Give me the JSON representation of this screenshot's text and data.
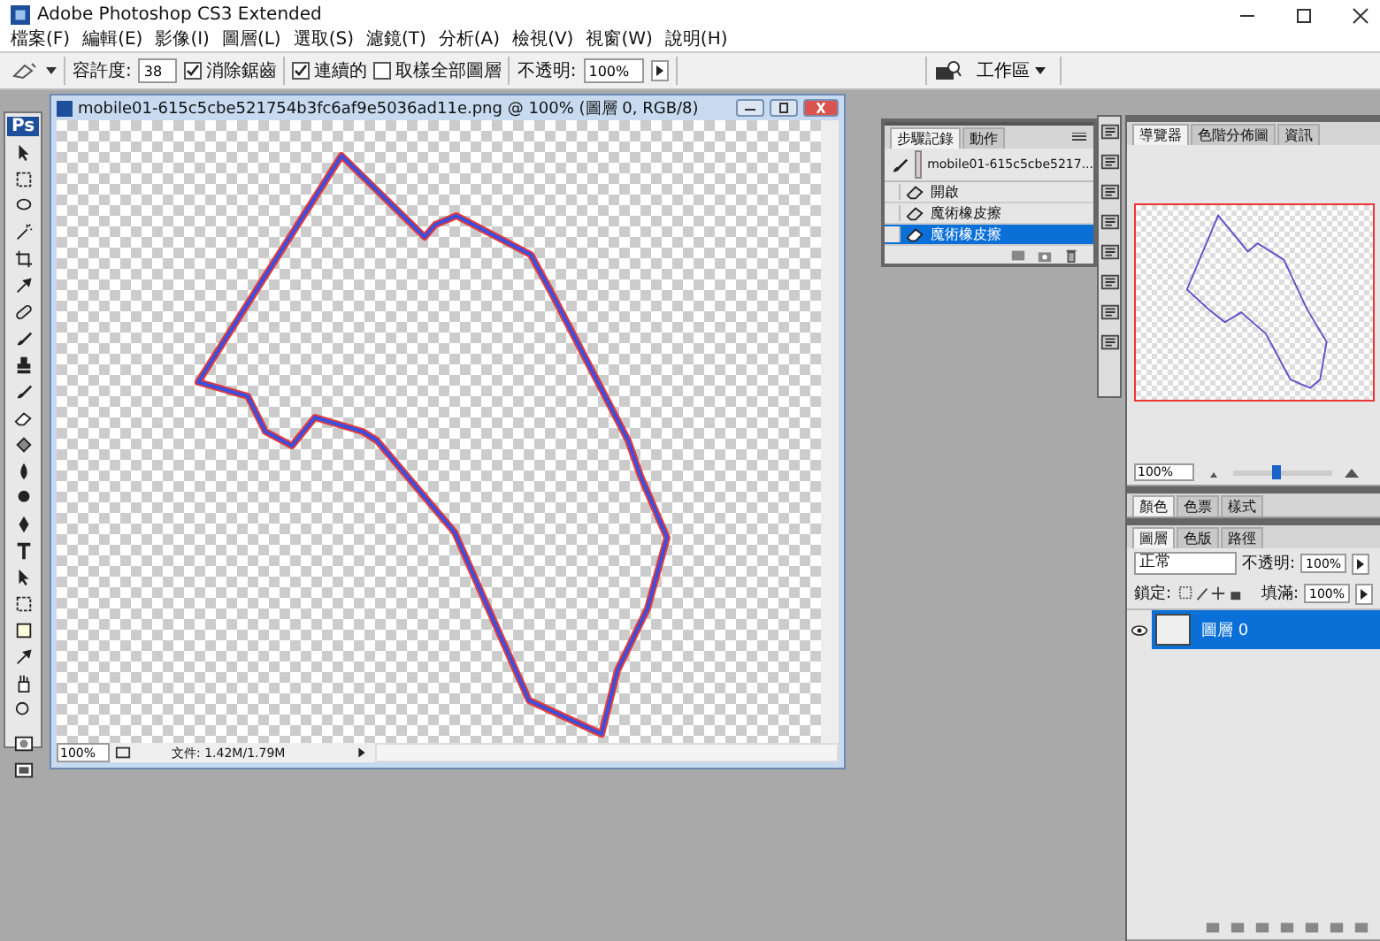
{
  "app_title": "Adobe Photoshop CS3 Extended",
  "menu": [
    "檔案(F)",
    "編輯(E)",
    "影像(I)",
    "圖層(L)",
    "選取(S)",
    "濾鏡(T)",
    "分析(A)",
    "檢視(V)",
    "視窗(W)",
    "說明(H)"
  ],
  "options": {
    "tolerance_label": "容許度:",
    "tolerance": "38",
    "checks": [
      {
        "label": "消除鋸齒",
        "checked": true
      },
      {
        "label": "連續的",
        "checked": true
      },
      {
        "label": "取樣全部圖層",
        "checked": false
      }
    ],
    "opacity_label": "不透明:",
    "opacity": "100%",
    "workspace": "工作區"
  },
  "toolbox": {
    "logo": "Ps"
  },
  "document": {
    "title": "mobile01-615c5cbe521754b3fc6af9e5036ad11e.png @ 100% (圖層 0, RGB/8)",
    "zoom": "100%",
    "status": "文件: 1.42M/1.79M"
  },
  "history": {
    "tabs": [
      {
        "label": "步驟記錄",
        "selected": true
      },
      {
        "label": "動作",
        "selected": false
      }
    ],
    "snapshot": "mobile01-615c5cbe5217...",
    "items": [
      {
        "label": "開啟",
        "selected": false
      },
      {
        "label": "魔術橡皮擦",
        "selected": false
      },
      {
        "label": "魔術橡皮擦",
        "selected": true
      }
    ]
  },
  "navigator": {
    "tabs": [
      {
        "label": "導覽器",
        "selected": true
      },
      {
        "label": "色階分佈圖",
        "selected": false
      },
      {
        "label": "資訊",
        "selected": false
      }
    ],
    "zoom": "100%",
    "level": 0.43
  },
  "color_panel": {
    "tabs": [
      {
        "label": "顏色",
        "selected": true
      },
      {
        "label": "色票",
        "selected": false
      },
      {
        "label": "樣式",
        "selected": false
      }
    ]
  },
  "layers": {
    "tabs": [
      {
        "label": "圖層",
        "selected": true
      },
      {
        "label": "色版",
        "selected": false
      },
      {
        "label": "路徑",
        "selected": false
      }
    ],
    "blend_mode": "正常",
    "opacity_label": "不透明:",
    "opacity": "100%",
    "lock_label": "鎖定:",
    "fill_label": "填滿:",
    "fill": "100%",
    "items": [
      {
        "name": "圖層 0",
        "visible": true,
        "selected": true
      }
    ]
  }
}
